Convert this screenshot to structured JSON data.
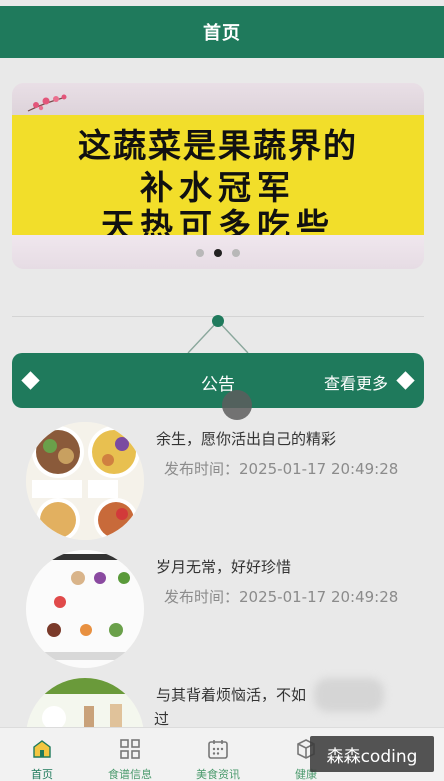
{
  "header": {
    "title": "首页"
  },
  "banner": {
    "line1": "这蔬菜是果蔬界的",
    "line2": "补水冠军",
    "line3": "天热可多吃些",
    "slide_count": 3,
    "active_slide": 2
  },
  "notice": {
    "title": "公告",
    "more_label": "查看更多"
  },
  "news": [
    {
      "title": "余生，愿你活出自己的精彩",
      "time": "发布时间：2025-01-17 20:49:28"
    },
    {
      "title": "岁月无常，好好珍惜",
      "time": "发布时间：2025-01-17 20:49:28"
    },
    {
      "title": "与其背着烦恼活，不如",
      "title_line2": "过",
      "time": ""
    }
  ],
  "tabbar": {
    "items": [
      {
        "label": "首页",
        "icon": "home-icon",
        "active": true
      },
      {
        "label": "食谱信息",
        "icon": "grid-icon",
        "active": false
      },
      {
        "label": "美食资讯",
        "icon": "calendar-icon",
        "active": false
      },
      {
        "label": "健康",
        "icon": "box-icon",
        "active": false
      }
    ]
  },
  "watermark": {
    "text": "森森coding"
  },
  "colors": {
    "primary": "#1f7a5c",
    "banner_yellow": "#f2de2a"
  }
}
